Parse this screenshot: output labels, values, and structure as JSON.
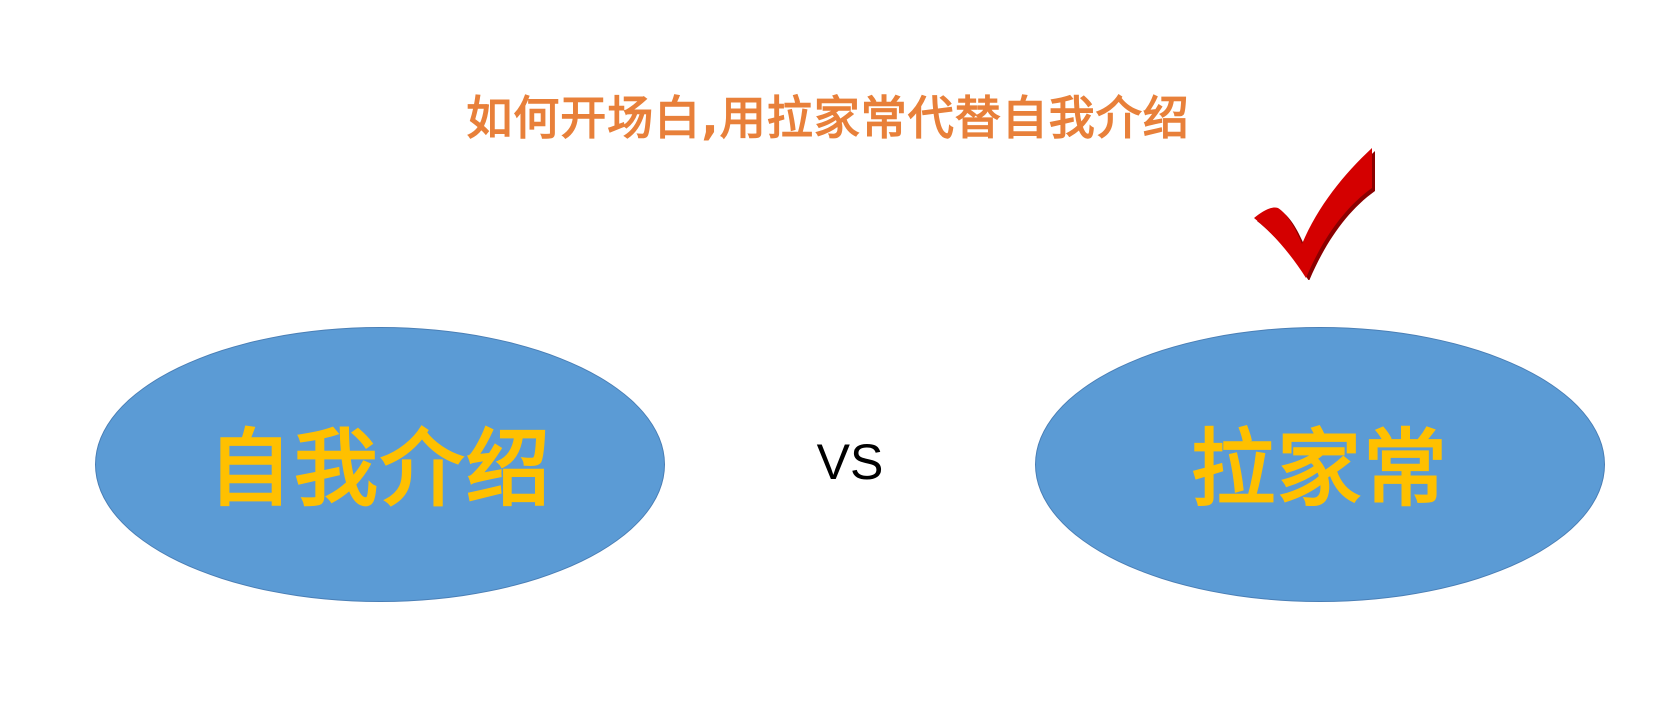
{
  "title": "如何开场白,用拉家常代替自我介绍",
  "left_option": {
    "label": "自我介绍"
  },
  "separator": "VS",
  "right_option": {
    "label": "拉家常",
    "marker_icon": "checkmark-icon"
  },
  "colors": {
    "title": "#e8803a",
    "ellipse_fill": "#5b9bd5",
    "ellipse_border": "#4a7fb6",
    "ellipse_text": "#ffc000",
    "checkmark": "#d40000",
    "checkmark_shadow": "#8a0000"
  }
}
